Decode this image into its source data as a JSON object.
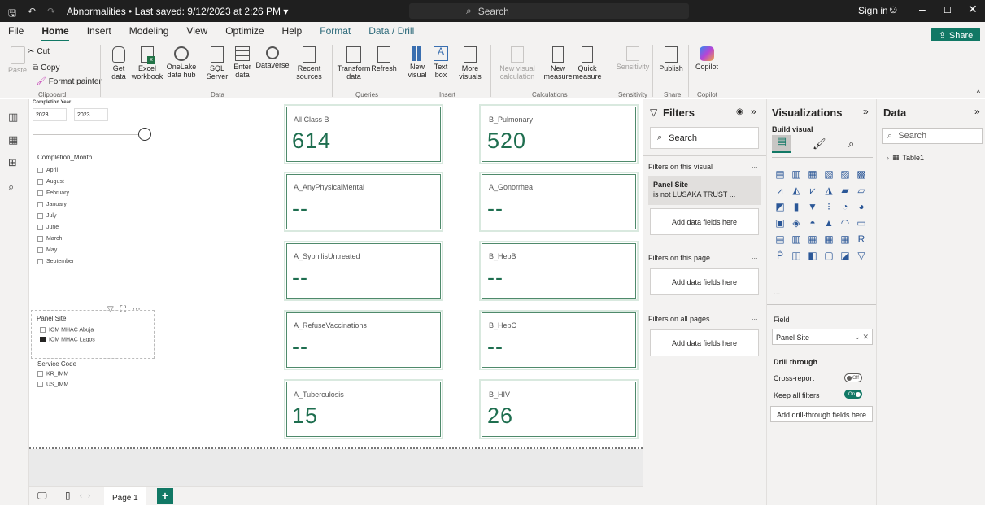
{
  "titlebar": {
    "doc_title": "Abnormalities • Last saved: 9/12/2023 at 2:26 PM ▾",
    "search_placeholder": "Search",
    "sign_in": "Sign in"
  },
  "menu": {
    "tabs": [
      "File",
      "Home",
      "Insert",
      "Modeling",
      "View",
      "Optimize",
      "Help",
      "Format",
      "Data / Drill"
    ],
    "active": "Home",
    "share": "Share"
  },
  "ribbon": {
    "clipboard": {
      "paste": "Paste",
      "cut": "Cut",
      "copy": "Copy",
      "format_painter": "Format painter",
      "label": "Clipboard"
    },
    "data": {
      "get_data": "Get data",
      "excel": "Excel workbook",
      "onelake": "OneLake data hub",
      "sql": "SQL Server",
      "enter": "Enter data",
      "dataverse": "Dataverse",
      "recent": "Recent sources",
      "label": "Data"
    },
    "queries": {
      "transform": "Transform data",
      "refresh": "Refresh",
      "label": "Queries"
    },
    "insert": {
      "new_visual": "New visual",
      "text_box": "Text box",
      "more": "More visuals",
      "label": "Insert"
    },
    "calculations": {
      "new_visual_calc": "New visual calculation",
      "new_measure": "New measure",
      "quick_measure": "Quick measure",
      "label": "Calculations"
    },
    "sensitivity": {
      "btn": "Sensitivity",
      "label": "Sensitivity"
    },
    "share": {
      "publish": "Publish",
      "label": "Share"
    },
    "copilot": {
      "btn": "Copilot",
      "label": "Copilot"
    }
  },
  "slicers": {
    "year": {
      "title": "Completion Year",
      "from": "2023",
      "to": "2023"
    },
    "month": {
      "title": "Completion_Month",
      "items": [
        "April",
        "August",
        "February",
        "January",
        "July",
        "June",
        "March",
        "May",
        "September"
      ]
    },
    "panel_site": {
      "title": "Panel Site",
      "items": [
        {
          "label": "IOM MHAC Abuja",
          "checked": false
        },
        {
          "label": "IOM MHAC Lagos",
          "checked": true
        }
      ]
    },
    "service_code": {
      "title": "Service Code",
      "items": [
        "KR_IMM",
        "US_IMM"
      ]
    }
  },
  "cards": [
    {
      "label": "All Class B",
      "value": "614"
    },
    {
      "label": "B_Pulmonary",
      "value": "520"
    },
    {
      "label": "A_AnyPhysicalMental",
      "value": "--"
    },
    {
      "label": "A_Gonorrhea",
      "value": "--"
    },
    {
      "label": "A_SyphilisUntreated",
      "value": "--"
    },
    {
      "label": "B_HepB",
      "value": "--"
    },
    {
      "label": "A_RefuseVaccinations",
      "value": "--"
    },
    {
      "label": "B_HepC",
      "value": "--"
    },
    {
      "label": "A_Tuberculosis",
      "value": "15"
    },
    {
      "label": "B_HIV",
      "value": "26"
    }
  ],
  "page_tabs": {
    "page1": "Page 1",
    "add": "+"
  },
  "filters": {
    "title": "Filters",
    "search": "Search",
    "on_visual": "Filters on this visual",
    "panel_site_title": "Panel Site",
    "panel_site_rule": "is not LUSAKA TRUST ...",
    "add_fields": "Add data fields here",
    "on_page": "Filters on this page",
    "on_all": "Filters on all pages",
    "more": "..."
  },
  "visualizations": {
    "title": "Visualizations",
    "build_visual": "Build visual",
    "field_label": "Field",
    "field_value": "Panel Site",
    "drill_through": "Drill through",
    "cross_report": "Cross-report",
    "cross_report_state": "Off",
    "keep_filters": "Keep all filters",
    "keep_filters_state": "On",
    "add_drill": "Add drill-through fields here",
    "more": "..."
  },
  "data_pane": {
    "title": "Data",
    "search": "Search",
    "table": "Table1"
  },
  "colors": {
    "accent": "#117865",
    "card_value": "#1e6e4f",
    "titlebar": "#1f1f1f"
  }
}
